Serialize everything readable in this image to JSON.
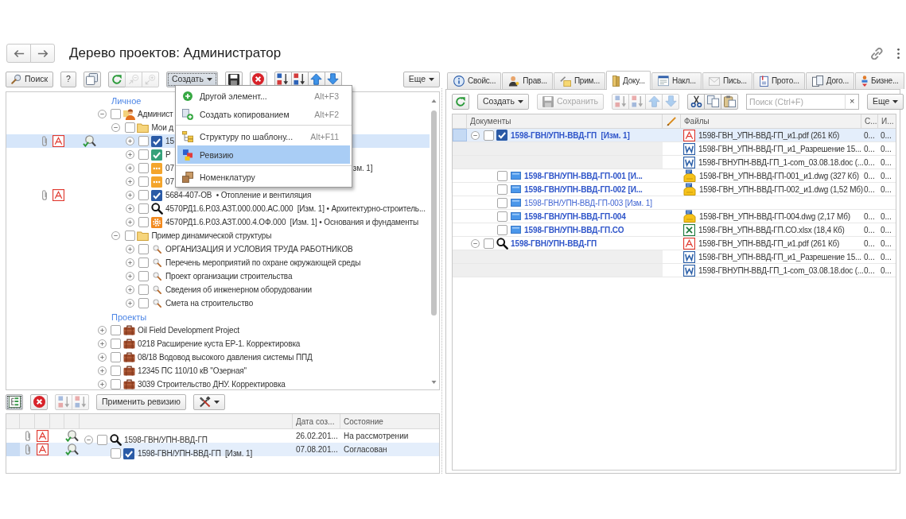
{
  "header": {
    "title": "Дерево проектов: Администратор"
  },
  "tree_toolbar": [
    {
      "buttons": [
        {
          "kind": "search",
          "label": "Поиск",
          "disabled": false,
          "pressed": false
        }
      ]
    },
    {
      "buttons": [
        {
          "kind": "help",
          "label": "?",
          "disabled": false,
          "pressed": false
        }
      ]
    },
    {
      "buttons": [
        {
          "kind": "windows",
          "disabled": false,
          "pressed": false
        }
      ]
    },
    {
      "buttons": [
        {
          "kind": "refresh",
          "disabled": false,
          "pressed": false
        },
        {
          "kind": "collapse",
          "disabled": true,
          "pressed": false
        },
        {
          "kind": "expand",
          "disabled": true,
          "pressed": false
        }
      ]
    },
    {
      "buttons": [
        {
          "kind": "create",
          "label": "Создать",
          "disabled": false,
          "pressed": true
        }
      ]
    },
    {
      "buttons": [
        {
          "kind": "save",
          "disabled": false,
          "pressed": false
        }
      ]
    },
    {
      "buttons": [
        {
          "kind": "cancel",
          "disabled": false,
          "pressed": false
        }
      ]
    },
    {
      "buttons": [
        {
          "kind": "sort_asc",
          "disabled": false,
          "pressed": false
        },
        {
          "kind": "sort_desc",
          "disabled": false,
          "pressed": false
        },
        {
          "kind": "up",
          "disabled": false,
          "pressed": false
        },
        {
          "kind": "down",
          "disabled": false,
          "pressed": false
        }
      ]
    },
    {
      "buttons": [
        {
          "kind": "more",
          "label": "Еще",
          "disabled": false,
          "pressed": false
        }
      ]
    }
  ],
  "create_menu": {
    "groups": [
      {
        "items": [
          {
            "kind": "add",
            "label": "Другой элемент...",
            "shortcut": "Alt+F3",
            "selected": false
          },
          {
            "kind": "copy_add",
            "label": "Создать копированием",
            "shortcut": "Alt+F2",
            "selected": false
          }
        ]
      },
      {
        "items": [
          {
            "kind": "template",
            "label": "Структуру по шаблону...",
            "shortcut": "Alt+F11",
            "selected": false
          },
          {
            "kind": "revision",
            "label": "Ревизию",
            "selected": true
          }
        ]
      },
      {
        "items": [
          {
            "kind": "nomenclature",
            "label": "Номенклатуру",
            "selected": false
          }
        ]
      }
    ]
  },
  "tree": {
    "groups": [
      {
        "title": "Личное",
        "nodes": [
          {
            "label": "Админист",
            "kind": "user",
            "expanded": true,
            "checked": false,
            "selected": false,
            "attachment": false,
            "pdf": false,
            "approval": false,
            "children": [
              {
                "label": "Мои д",
                "kind": "folder",
                "expanded": true,
                "checked": false,
                "selected": false,
                "attachment": false,
                "pdf": false,
                "approval": false,
                "children": [
                  {
                    "label": "15",
                    "kind": "approved",
                    "expanded": false,
                    "checked": false,
                    "selected": true,
                    "attachment": true,
                    "pdf": true,
                    "approval": true
                  },
                  {
                    "label": "Р",
                    "kind": "signed",
                    "expanded": false,
                    "checked": false,
                    "selected": false,
                    "attachment": false,
                    "pdf": false,
                    "approval": false
                  },
                  {
                    "label": "07",
                    "tail": "зм. 1]",
                    "kind": "draft",
                    "expanded": false,
                    "checked": false,
                    "selected": false,
                    "attachment": false,
                    "pdf": false,
                    "approval": false
                  },
                  {
                    "label": "07",
                    "kind": "draft",
                    "expanded": false,
                    "checked": false,
                    "selected": false,
                    "attachment": false,
                    "pdf": false,
                    "approval": false
                  },
                  {
                    "label": "5684-407-ОВ  • Отопление и вентиляция",
                    "kind": "approved",
                    "expanded": false,
                    "checked": false,
                    "selected": false,
                    "attachment": true,
                    "pdf": true,
                    "approval": false
                  },
                  {
                    "label": "4570РД1.6.Р.03.АЗТ.000.000.АС.000  [Изм. 1] • Архитектурно-строитель...",
                    "kind": "review",
                    "expanded": false,
                    "checked": false,
                    "selected": false,
                    "attachment": false,
                    "pdf": false,
                    "approval": false
                  },
                  {
                    "label": "4570РД1.6.Р.03.АЗТ.000.4.ОФ.000  [Изм. 1] • Основания и фундаменты",
                    "kind": "work",
                    "expanded": false,
                    "checked": false,
                    "selected": false,
                    "attachment": false,
                    "pdf": false,
                    "approval": false
                  }
                ]
              },
              {
                "label": "Пример динамической структуры",
                "kind": "folder",
                "expanded": true,
                "checked": false,
                "selected": false,
                "attachment": false,
                "pdf": false,
                "approval": false,
                "children": [
                  {
                    "label": "ОРГАНИЗАЦИЯ И УСЛОВИЯ ТРУДА РАБОТНИКОВ",
                    "kind": "section",
                    "expanded": false,
                    "checked": false,
                    "selected": false,
                    "attachment": false,
                    "pdf": false,
                    "approval": false
                  },
                  {
                    "label": "Перечень мероприятий по охране окружающей среды",
                    "kind": "section",
                    "expanded": false,
                    "checked": false,
                    "selected": false,
                    "attachment": false,
                    "pdf": false,
                    "approval": false
                  },
                  {
                    "label": "Проект организации строительства",
                    "kind": "section",
                    "expanded": false,
                    "checked": false,
                    "selected": false,
                    "attachment": false,
                    "pdf": false,
                    "approval": false
                  },
                  {
                    "label": "Сведения об инженерном оборудовании",
                    "kind": "section",
                    "expanded": false,
                    "checked": false,
                    "selected": false,
                    "attachment": false,
                    "pdf": false,
                    "approval": false
                  },
                  {
                    "label": "Смета на строительство",
                    "kind": "section",
                    "expanded": false,
                    "checked": false,
                    "selected": false,
                    "attachment": false,
                    "pdf": false,
                    "approval": false
                  }
                ]
              }
            ]
          }
        ]
      },
      {
        "title": "Проекты",
        "nodes": [
          {
            "label": "Oil Field Development Project",
            "kind": "project",
            "expanded": false,
            "checked": false,
            "selected": false,
            "attachment": false,
            "pdf": false,
            "approval": false
          },
          {
            "label": "0218 Расширение куста ЕР-1. Корректировка",
            "kind": "project",
            "expanded": false,
            "checked": false,
            "selected": false,
            "attachment": false,
            "pdf": false,
            "approval": false
          },
          {
            "label": "08/18 Водовод высокого давления системы ППД",
            "kind": "project",
            "expanded": false,
            "checked": false,
            "selected": false,
            "attachment": false,
            "pdf": false,
            "approval": false
          },
          {
            "label": "12345 ПС 110/10 кВ \"Озерная\"",
            "kind": "project",
            "expanded": false,
            "checked": false,
            "selected": false,
            "attachment": false,
            "pdf": false,
            "approval": false
          },
          {
            "label": "3039 Строительство ДНУ. Корректировка",
            "kind": "project",
            "expanded": false,
            "checked": false,
            "selected": false,
            "attachment": false,
            "pdf": false,
            "approval": false
          }
        ]
      }
    ]
  },
  "revision_toolbar": [
    {
      "buttons": [
        {
          "kind": "tree",
          "disabled": false,
          "pressed": true
        }
      ]
    },
    {
      "buttons": [
        {
          "kind": "cancel",
          "disabled": false,
          "pressed": false
        }
      ]
    },
    {
      "buttons": [
        {
          "kind": "sort_asc",
          "disabled": true,
          "pressed": false
        },
        {
          "kind": "sort_desc",
          "disabled": true,
          "pressed": false
        }
      ]
    },
    {
      "buttons": [
        {
          "kind": "apply",
          "label": "Применить ревизию",
          "disabled": false,
          "pressed": false
        }
      ]
    },
    {
      "buttons": [
        {
          "kind": "tools",
          "disabled": false,
          "pressed": false
        }
      ]
    }
  ],
  "revisions": {
    "columns": [
      "Дата соз...",
      "Состояние"
    ],
    "rows": [
      {
        "label": "1598-ГВН/УПН-ВВД-ГП",
        "kind": "review",
        "expanded": true,
        "checked": false,
        "selected": false,
        "attachment": true,
        "pdf": true,
        "approval": true,
        "date": "26.02.201...",
        "state": "На рассмотрении",
        "children": [
          {
            "label": "1598-ГВН/УПН-ВВД-ГП  [Изм. 1]",
            "kind": "approved",
            "checked": false,
            "selected": true,
            "attachment": true,
            "pdf": true,
            "approval": true,
            "date": "07.08.201...",
            "state": "Согласован"
          }
        ]
      }
    ]
  },
  "tabs": [
    {
      "label": "Свойс...",
      "kind": "info",
      "selected": false
    },
    {
      "label": "Прав...",
      "kind": "rights",
      "selected": false
    },
    {
      "label": "Прим...",
      "kind": "notes",
      "selected": false
    },
    {
      "label": "Доку...",
      "kind": "docs",
      "selected": true
    },
    {
      "label": "Накл...",
      "kind": "invoice",
      "selected": false
    },
    {
      "label": "Пись...",
      "kind": "letters",
      "selected": false
    },
    {
      "label": "Прото...",
      "kind": "protocols",
      "selected": false
    },
    {
      "label": "Дого...",
      "kind": "contracts",
      "selected": false
    },
    {
      "label": "Бизне...",
      "kind": "business",
      "selected": false
    }
  ],
  "documents_toolbar": [
    {
      "buttons": [
        {
          "kind": "refresh",
          "disabled": false,
          "pressed": false
        }
      ]
    },
    {
      "buttons": [
        {
          "kind": "create",
          "label": "Создать",
          "disabled": false,
          "pressed": false
        }
      ]
    },
    {
      "buttons": [
        {
          "kind": "save",
          "label": "Сохранить",
          "disabled": true,
          "pressed": false
        }
      ]
    },
    {
      "buttons": [
        {
          "kind": "sort_asc",
          "disabled": true,
          "pressed": false
        },
        {
          "kind": "sort_desc",
          "disabled": true,
          "pressed": false
        },
        {
          "kind": "up",
          "disabled": true,
          "pressed": false
        },
        {
          "kind": "down",
          "disabled": true,
          "pressed": false
        }
      ]
    },
    {
      "buttons": [
        {
          "kind": "cut",
          "disabled": false,
          "pressed": false
        },
        {
          "kind": "copy",
          "disabled": false,
          "pressed": false
        },
        {
          "kind": "paste",
          "disabled": false,
          "pressed": false
        }
      ]
    },
    {
      "field": {
        "placeholder": "Поиск (Ctrl+F)",
        "clear": "×"
      }
    },
    {
      "buttons": [
        {
          "kind": "more",
          "label": "Еще",
          "disabled": false,
          "pressed": false
        }
      ]
    }
  ],
  "documents": {
    "columns": [
      "Документы",
      "Файлы",
      "С...",
      "И..."
    ],
    "rows": [
      {
        "label": "1598-ГВН/УПН-ВВД-ГП  [Изм. 1]",
        "kind": "approved",
        "bold": true,
        "expanded": true,
        "checked": false,
        "selected": true,
        "files": [
          {
            "kind": "pdf",
            "name": "1598-ГВН_УПН-ВВД-ГП_и1.pdf (261 Кб)",
            "cells": [
              "0...",
              "0..."
            ]
          },
          {
            "kind": "word",
            "name": "1598-ГВН_УПН-ВВД-ГП_и1_Разрешение 15...",
            "cells": [
              "0...",
              "0..."
            ]
          },
          {
            "kind": "word",
            "name": "1598-ГВНУПН-ВВД-ГП_1-com_03.08.18.doc (...",
            "cells": [
              "0...",
              "0..."
            ]
          }
        ],
        "children": [
          {
            "label": "1598-ГВН/УПН-ВВД-ГП-001 [И...",
            "kind": "sheet",
            "bold": true,
            "checked": false,
            "selected": false,
            "files": [
              {
                "kind": "dwg",
                "name": "1598-ГВН_УПН-ВВД-ГП-001_и1.dwg (327 Кб)",
                "cells": [
                  "0...",
                  "0..."
                ]
              }
            ]
          },
          {
            "label": "1598-ГВН/УПН-ВВД-ГП-002 [И...",
            "kind": "sheet",
            "bold": true,
            "checked": false,
            "selected": false,
            "files": [
              {
                "kind": "dwg",
                "name": "1598-ГВН_УПН-ВВД-ГП-002_и1.dwg (1,52 Мб)",
                "cells": [
                  "0...",
                  "0..."
                ]
              }
            ]
          },
          {
            "label": "1598-ГВН/УПН-ВВД-ГП-003 [Изм. 1]",
            "kind": "sheet",
            "bold": false,
            "checked": false,
            "selected": false
          },
          {
            "label": "1598-ГВН/УПН-ВВД-ГП-004",
            "kind": "sheet",
            "bold": true,
            "checked": false,
            "selected": false,
            "files": [
              {
                "kind": "dwg",
                "name": "1598-ГВН_УПН-ВВД-ГП-004.dwg (2,17 Мб)",
                "cells": [
                  "0...",
                  "0..."
                ]
              }
            ]
          },
          {
            "label": "1598-ГВН/УПН-ВВД-ГП.СО",
            "kind": "sheet",
            "bold": true,
            "checked": false,
            "selected": false,
            "files": [
              {
                "kind": "excel",
                "name": "1598-ГВН_УПН-ВВД-ГП.СО.xlsx (18,4 Кб)",
                "cells": [
                  "0...",
                  "0..."
                ]
              }
            ]
          }
        ]
      },
      {
        "label": "1598-ГВН/УПН-ВВД-ГП",
        "kind": "review",
        "bold": true,
        "expanded": true,
        "checked": false,
        "selected": false,
        "files": [
          {
            "kind": "pdf",
            "name": "1598-ГВН_УПН-ВВД-ГП_и1.pdf (261 Кб)",
            "cells": [
              "0...",
              "0..."
            ]
          },
          {
            "kind": "word",
            "name": "1598-ГВН_УПН-ВВД-ГП_и1_Разрешение 15...",
            "cells": [
              "0...",
              "0..."
            ]
          },
          {
            "kind": "word",
            "name": "1598-ГВНУПН-ВВД-ГП_1-com_03.08.18.doc (...",
            "cells": [
              "0...",
              "0..."
            ]
          }
        ]
      }
    ]
  }
}
